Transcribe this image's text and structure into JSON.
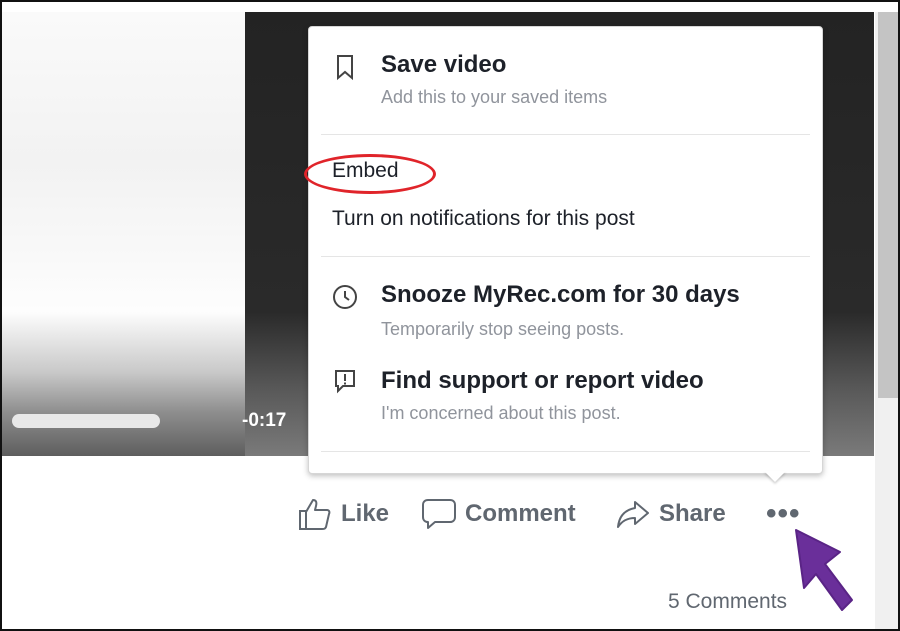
{
  "video": {
    "time_remaining": "-0:17",
    "progress_fraction": 0.33
  },
  "menu": {
    "save": {
      "title": "Save video",
      "subtitle": "Add this to your saved items",
      "icon": "bookmark-icon"
    },
    "embed": {
      "label": "Embed"
    },
    "notifications": {
      "label": "Turn on notifications for this post"
    },
    "snooze": {
      "title": "Snooze MyRec.com for 30 days",
      "subtitle": "Temporarily stop seeing posts.",
      "icon": "clock-icon"
    },
    "report": {
      "title": "Find support or report video",
      "subtitle": "I'm concerned about this post.",
      "icon": "report-flag-icon"
    }
  },
  "actions": {
    "like": {
      "label": "Like",
      "icon": "thumbs-up-icon"
    },
    "comment": {
      "label": "Comment",
      "icon": "speech-bubble-icon"
    },
    "share": {
      "label": "Share",
      "icon": "share-arrow-icon"
    },
    "more": {
      "label": "•••",
      "icon": "more-options-icon"
    }
  },
  "comments_count": "5 Comments",
  "colors": {
    "highlight_circle": "#e0242a",
    "cursor_arrow": "#6a2f9a",
    "text_primary": "#1d2129",
    "text_secondary": "#90949c",
    "action_text": "#606770"
  }
}
